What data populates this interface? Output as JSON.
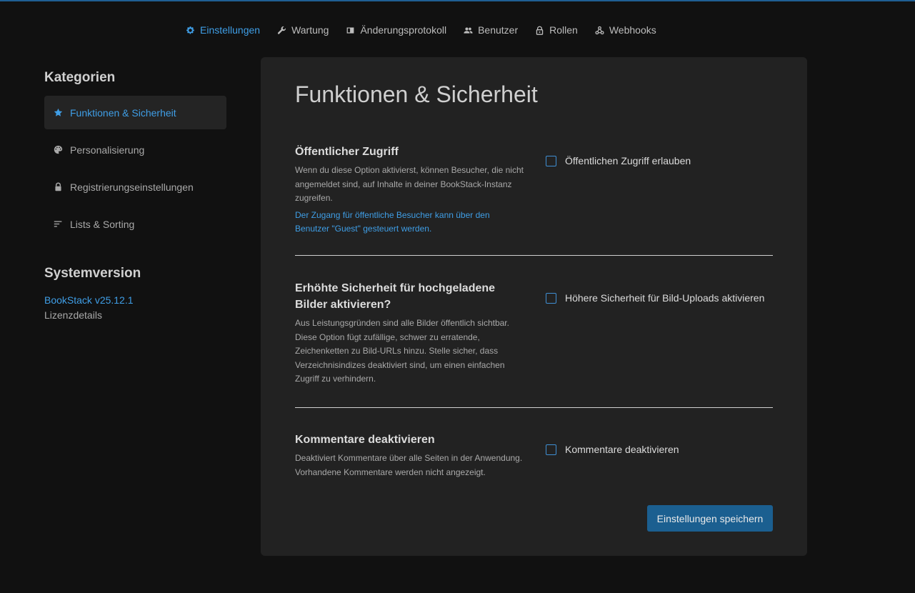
{
  "nav": {
    "items": [
      {
        "label": "Einstellungen",
        "icon": "gear-icon",
        "active": true
      },
      {
        "label": "Wartung",
        "icon": "wrench-icon",
        "active": false
      },
      {
        "label": "Änderungsprotokoll",
        "icon": "audit-log-icon",
        "active": false
      },
      {
        "label": "Benutzer",
        "icon": "users-icon",
        "active": false
      },
      {
        "label": "Rollen",
        "icon": "lock-icon",
        "active": false
      },
      {
        "label": "Webhooks",
        "icon": "webhooks-icon",
        "active": false
      }
    ]
  },
  "sidebar": {
    "heading": "Kategorien",
    "items": [
      {
        "label": "Funktionen & Sicherheit",
        "icon": "star-icon",
        "active": true
      },
      {
        "label": "Personalisierung",
        "icon": "palette-icon",
        "active": false
      },
      {
        "label": "Registrierungseinstellungen",
        "icon": "lock-icon",
        "active": false
      },
      {
        "label": "Lists & Sorting",
        "icon": "sort-icon",
        "active": false
      }
    ],
    "system_heading": "Systemversion",
    "version": "BookStack v25.12.1",
    "license": "Lizenzdetails"
  },
  "main": {
    "title": "Funktionen & Sicherheit",
    "settings": [
      {
        "title": "Öffentlicher Zugriff",
        "description": "Wenn du diese Option aktivierst, können Besucher, die nicht angemeldet sind, auf Inhalte in deiner BookStack-Instanz zugreifen.",
        "link": "Der Zugang für öffentliche Besucher kann über den Benutzer \"Guest\" gesteuert werden.",
        "checkbox_label": "Öffentlichen Zugriff erlauben",
        "checked": false
      },
      {
        "title": "Erhöhte Sicherheit für hochgeladene Bilder aktivieren?",
        "description": "Aus Leistungsgründen sind alle Bilder öffentlich sichtbar. Diese Option fügt zufällige, schwer zu erratende, Zeichenketten zu Bild-URLs hinzu. Stelle sicher, dass Verzeichnisindizes deaktiviert sind, um einen einfachen Zugriff zu verhindern.",
        "checkbox_label": "Höhere Sicherheit für Bild-Uploads aktivieren",
        "checked": false
      },
      {
        "title": "Kommentare deaktivieren",
        "description": "Deaktiviert Kommentare über alle Seiten in der Anwendung. Vorhandene Kommentare werden nicht angezeigt.",
        "checkbox_label": "Kommentare deaktivieren",
        "checked": false
      }
    ],
    "save_label": "Einstellungen speichern"
  },
  "colors": {
    "accent": "#3f9ee6",
    "button": "#1b5f90",
    "background": "#111111",
    "card": "#222222"
  }
}
